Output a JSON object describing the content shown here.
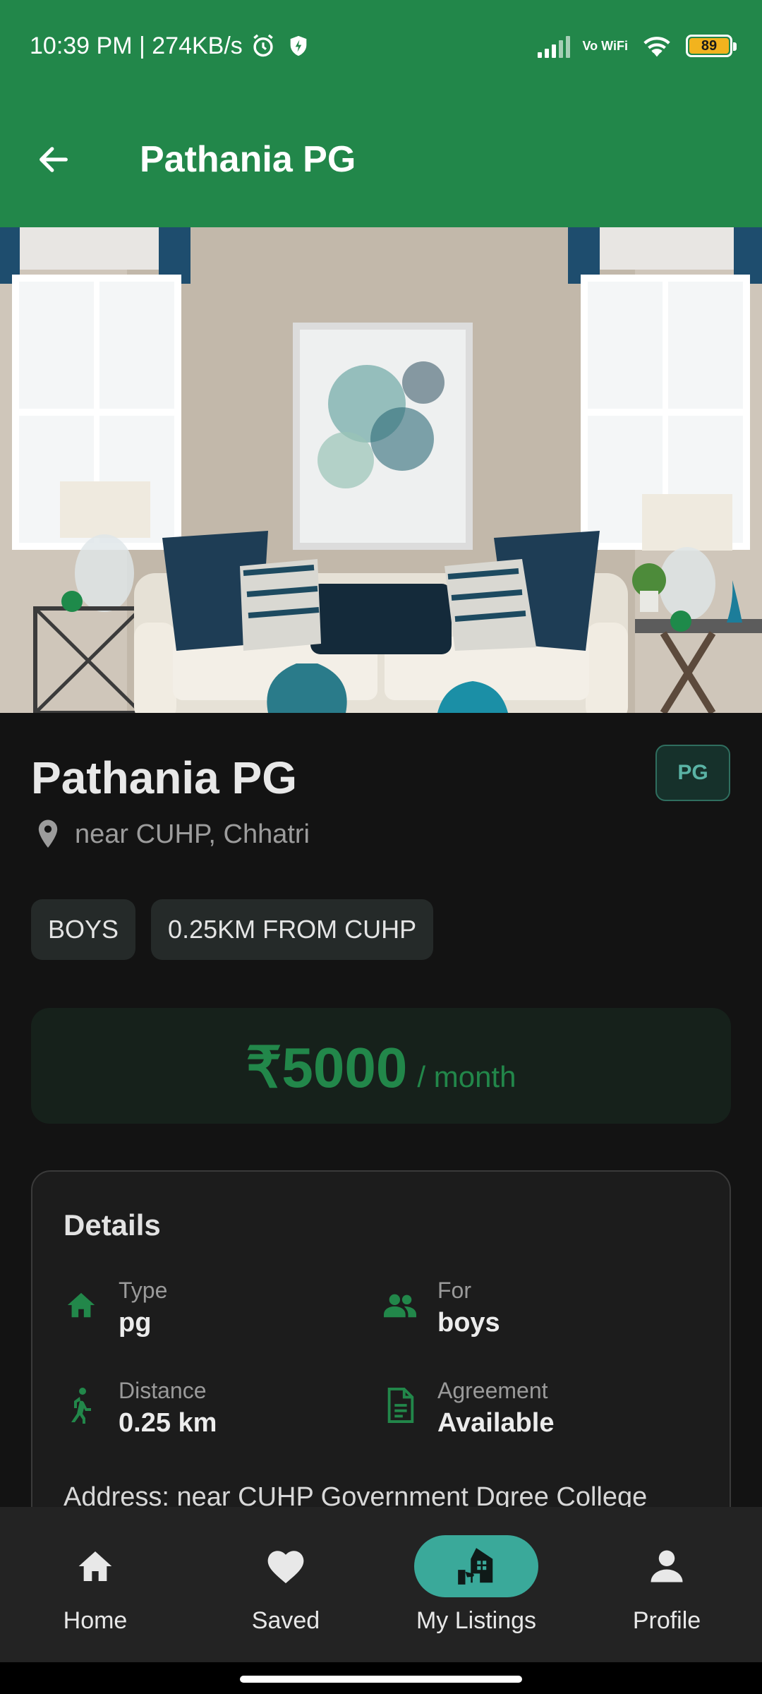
{
  "status_bar": {
    "time": "10:39 PM | 274KB/s",
    "network_label": "Vo WiFi",
    "battery": "89"
  },
  "app_bar": {
    "title": "Pathania PG"
  },
  "listing": {
    "title": "Pathania PG",
    "type_badge": "PG",
    "location": "near CUHP, Chhatri",
    "chips": [
      "BOYS",
      "0.25KM FROM CUHP"
    ],
    "price": "₹5000",
    "price_period": "/ month"
  },
  "details": {
    "title": "Details",
    "items": [
      {
        "label": "Type",
        "value": "pg",
        "icon": "home-icon"
      },
      {
        "label": "For",
        "value": "boys",
        "icon": "people-icon"
      },
      {
        "label": "Distance",
        "value": "0.25 km",
        "icon": "walk-icon"
      },
      {
        "label": "Agreement",
        "value": "Available",
        "icon": "document-icon"
      }
    ],
    "address": "Address: near CUHP Government Dgree College"
  },
  "bottom_nav": {
    "items": [
      {
        "label": "Home",
        "icon": "home-icon",
        "active": false
      },
      {
        "label": "Saved",
        "icon": "heart-icon",
        "active": false
      },
      {
        "label": "My Listings",
        "icon": "listings-icon",
        "active": true
      },
      {
        "label": "Profile",
        "icon": "person-icon",
        "active": false
      }
    ]
  },
  "colors": {
    "primary": "#22874a",
    "accent": "#3aa99a",
    "background": "#131313"
  }
}
